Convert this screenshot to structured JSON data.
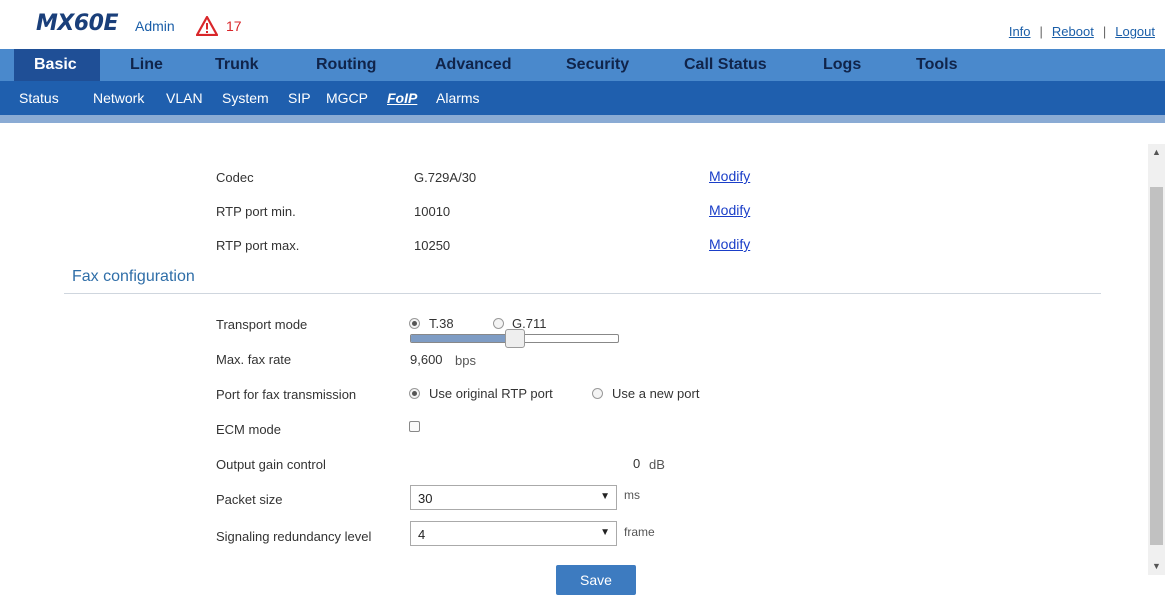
{
  "header": {
    "logo": "MX60E",
    "user": "Admin",
    "alarm_count": "17",
    "links": [
      "Info",
      "Reboot",
      "Logout"
    ]
  },
  "main_nav": {
    "tabs": [
      "Basic",
      "Line",
      "Trunk",
      "Routing",
      "Advanced",
      "Security",
      "Call Status",
      "Logs",
      "Tools"
    ],
    "active": "Basic"
  },
  "sub_nav": {
    "items": [
      "Status",
      "Network",
      "VLAN",
      "System",
      "SIP",
      "MGCP",
      "FoIP",
      "Alarms"
    ],
    "active": "FoIP"
  },
  "codec_settings": [
    {
      "label": "Codec",
      "value": "G.729A/30",
      "action": "Modify"
    },
    {
      "label": "RTP port min.",
      "value": "10010",
      "action": "Modify"
    },
    {
      "label": "RTP port max.",
      "value": "10250",
      "action": "Modify"
    }
  ],
  "fax": {
    "section_title": "Fax configuration",
    "transport_mode": {
      "label": "Transport mode",
      "options": [
        "T.38",
        "G.711"
      ],
      "selected": "T.38"
    },
    "max_fax_rate": {
      "label": "Max. fax rate",
      "value": "9,600",
      "unit": "bps"
    },
    "fax_port": {
      "label": "Port for fax transmission",
      "options": [
        "Use original RTP port",
        "Use a new port"
      ],
      "selected": "Use original RTP port"
    },
    "ecm_mode": {
      "label": "ECM mode",
      "checked": false
    },
    "output_gain": {
      "label": "Output gain control",
      "value": "0",
      "unit": "dB",
      "slider_fraction": 0.5
    },
    "packet_size": {
      "label": "Packet size",
      "value": "30",
      "unit": "ms"
    },
    "signaling_redundancy": {
      "label": "Signaling redundancy level",
      "value": "4",
      "unit": "frame"
    }
  },
  "save_label": "Save",
  "colors": {
    "nav_bar": "#4a89cc",
    "nav_active": "#1f4f96",
    "subnav_bar": "#1f5fae",
    "section_title": "#2f6ea8",
    "link": "#1a3ec8",
    "alarm": "#d9262a",
    "save_button": "#3d7bc0"
  },
  "icons": {
    "alarm": "warning-triangle-icon",
    "select_arrow": "caret-down-icon"
  }
}
